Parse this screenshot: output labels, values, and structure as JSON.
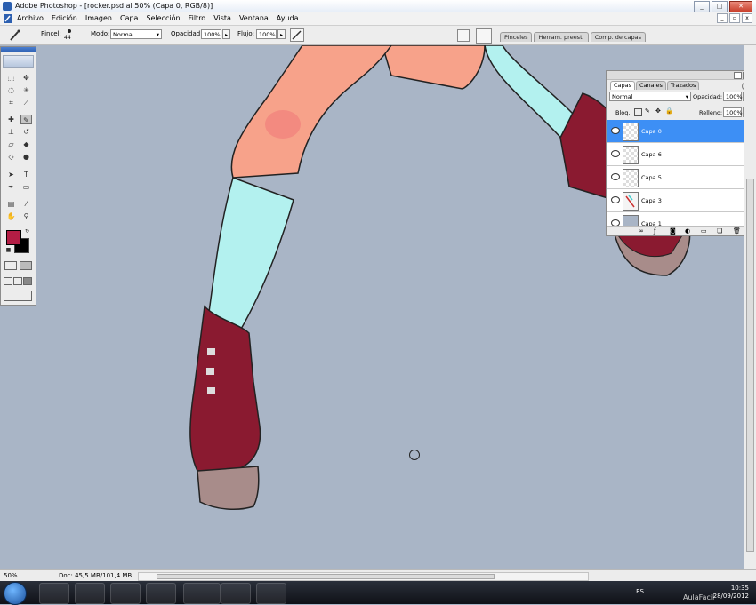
{
  "window": {
    "title": "Adobe Photoshop - [rocker.psd al 50% (Capa 0, RGB/8)]",
    "buttons": [
      "_",
      "□",
      "✕"
    ]
  },
  "menu": [
    "Archivo",
    "Edición",
    "Imagen",
    "Capa",
    "Selección",
    "Filtro",
    "Vista",
    "Ventana",
    "Ayuda"
  ],
  "options": {
    "brush_label": "Pincel:",
    "brush_size": "44",
    "mode_label": "Modo:",
    "mode_value": "Normal",
    "opacity_label": "Opacidad:",
    "opacity_value": "100%",
    "flow_label": "Flujo:",
    "flow_value": "100%",
    "palette_wells": [
      "Pinceles",
      "Herram. preest.",
      "Comp. de capas"
    ]
  },
  "colors": {
    "foreground": "#b31d44",
    "background": "#000000",
    "canvas": "#a9b5c6"
  },
  "layers_panel": {
    "tabs": [
      "Capas",
      "Canales",
      "Trazados"
    ],
    "blend_mode": "Normal",
    "opacity_label": "Opacidad:",
    "opacity_value": "100%",
    "lock_label": "Bloq.:",
    "fill_label": "Relleno:",
    "fill_value": "100%",
    "layers": [
      {
        "name": "Capa 0",
        "active": true
      },
      {
        "name": "Capa 6",
        "active": false
      },
      {
        "name": "Capa 5",
        "active": false
      },
      {
        "name": "Capa 3",
        "active": false
      },
      {
        "name": "Capa 1",
        "active": false
      }
    ]
  },
  "status": {
    "zoom": "50%",
    "doc": "Doc: 45,5 MB/101,4 MB"
  },
  "taskbar": {
    "lang": "ES",
    "time": "10:35",
    "date": "28/09/2012"
  },
  "watermark": "AulaFacil"
}
